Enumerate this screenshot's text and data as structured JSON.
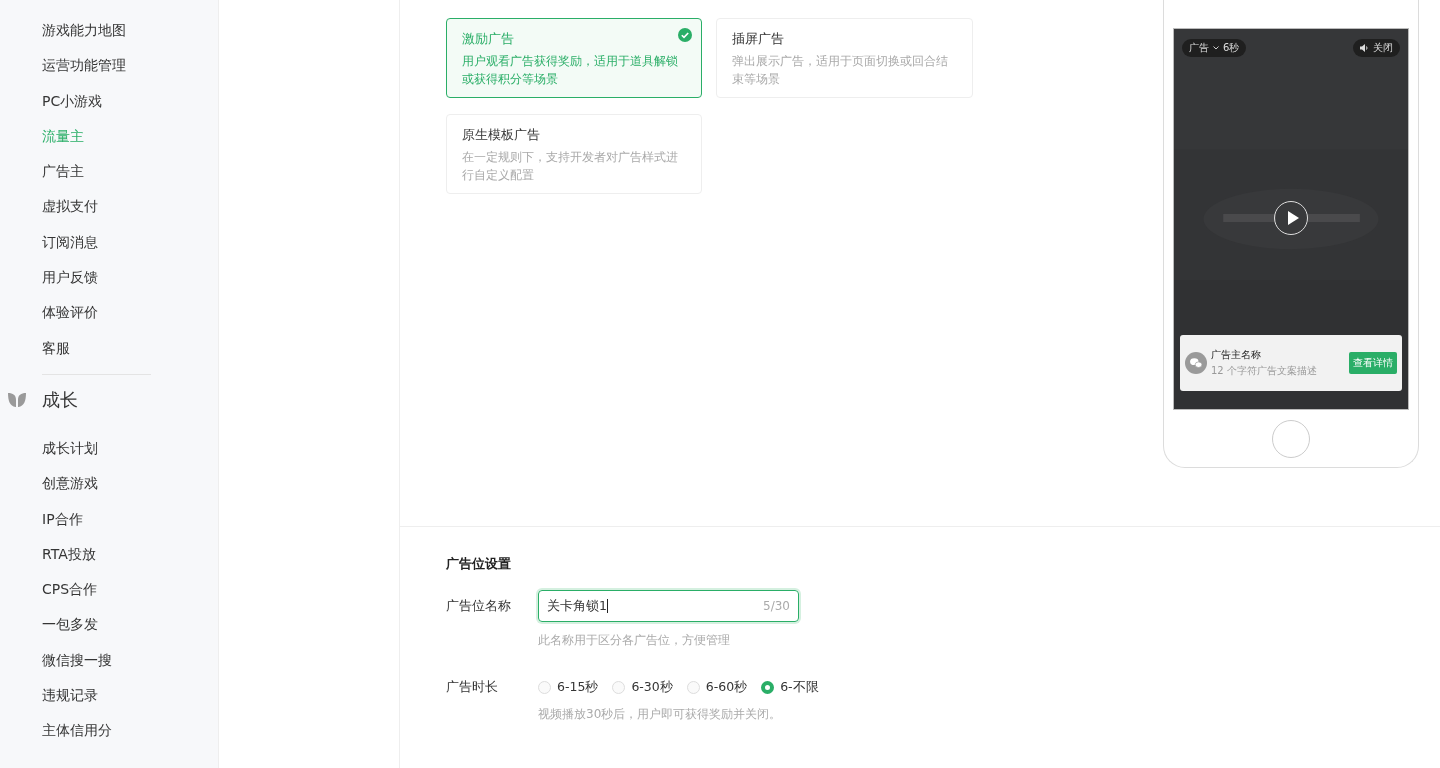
{
  "sidebar": {
    "groups": [
      {
        "items": [
          {
            "label": "游戏能力地图",
            "selected": false
          },
          {
            "label": "运营功能管理",
            "selected": false
          },
          {
            "label": "PC小游戏",
            "selected": false
          },
          {
            "label": "流量主",
            "selected": true
          },
          {
            "label": "广告主",
            "selected": false
          },
          {
            "label": "虚拟支付",
            "selected": false
          },
          {
            "label": "订阅消息",
            "selected": false
          },
          {
            "label": "用户反馈",
            "selected": false
          },
          {
            "label": "体验评价",
            "selected": false
          },
          {
            "label": "客服",
            "selected": false
          }
        ]
      },
      {
        "title": "成长",
        "items": [
          {
            "label": "成长计划",
            "selected": false
          },
          {
            "label": "创意游戏",
            "selected": false
          },
          {
            "label": "IP合作",
            "selected": false
          },
          {
            "label": "RTA投放",
            "selected": false
          },
          {
            "label": "CPS合作",
            "selected": false
          },
          {
            "label": "一包多发",
            "selected": false
          },
          {
            "label": "微信搜一搜",
            "selected": false
          },
          {
            "label": "违规记录",
            "selected": false
          },
          {
            "label": "主体信用分",
            "selected": false
          }
        ]
      }
    ]
  },
  "ad_types": [
    {
      "title": "激励广告",
      "description": "用户观看广告获得奖励，适用于道具解锁或获得积分等场景",
      "selected": true
    },
    {
      "title": "插屏广告",
      "description": "弹出展示广告，适用于页面切换或回合结束等场景",
      "selected": false
    },
    {
      "title": "原生模板广告",
      "description": "在一定规则下，支持开发者对广告样式进行自定义配置",
      "selected": false
    }
  ],
  "preview": {
    "ad_label": "广告",
    "countdown": "6秒",
    "close": "关闭",
    "advertiser": "广告主名称",
    "description": "12 个字符广告文案描述",
    "button": "查看详情"
  },
  "settings": {
    "title": "广告位设置",
    "name_field": {
      "label": "广告位名称",
      "value": "关卡角锁1",
      "counter": "5/30",
      "hint": "此名称用于区分各广告位，方便管理"
    },
    "duration": {
      "label": "广告时长",
      "options": [
        {
          "label": "6-15秒",
          "selected": false
        },
        {
          "label": "6-30秒",
          "selected": false
        },
        {
          "label": "6-60秒",
          "selected": false
        },
        {
          "label": "6-不限",
          "selected": true
        }
      ],
      "hint": "视频播放30秒后，用户即可获得奖励并关闭。"
    }
  }
}
